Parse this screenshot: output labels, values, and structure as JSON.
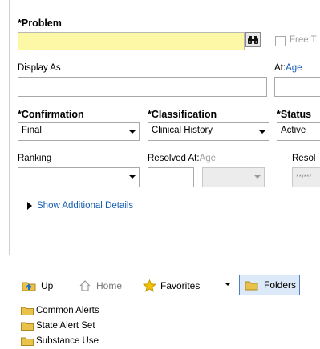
{
  "problem": {
    "label": "*Problem",
    "value": ""
  },
  "free_text": {
    "label": "Free T",
    "checked": false
  },
  "display_as": {
    "label": "Display As",
    "value": ""
  },
  "at": {
    "label": "At:",
    "link": "Age"
  },
  "confirmation": {
    "label": "*Confirmation",
    "value": "Final"
  },
  "classification": {
    "label": "*Classification",
    "value": "Clinical History"
  },
  "status": {
    "label": "*Status",
    "value": "Active"
  },
  "ranking": {
    "label": "Ranking",
    "value": ""
  },
  "resolved_at": {
    "label": "Resolved At:",
    "link": "Age",
    "date_placeholder": "**/**/"
  },
  "resolved_truncated": {
    "label": "Resol"
  },
  "show_details": {
    "label": "Show Additional Details"
  },
  "toolbar": {
    "up": "Up",
    "home": "Home",
    "favorites": "Favorites",
    "folders": "Folders"
  },
  "tree": {
    "items": [
      "Common Alerts",
      "State Alert Set",
      "Substance Use"
    ]
  },
  "colors": {
    "problem_bg": "#fdf8a6",
    "link": "#1a5fb4",
    "folder": "#e8c24a"
  },
  "icons": [
    "binoculars-icon",
    "checkbox-icon",
    "dropdown-arrow-icon",
    "triangle-right-icon",
    "up-folder-icon",
    "home-icon",
    "star-icon",
    "folder-icon"
  ]
}
